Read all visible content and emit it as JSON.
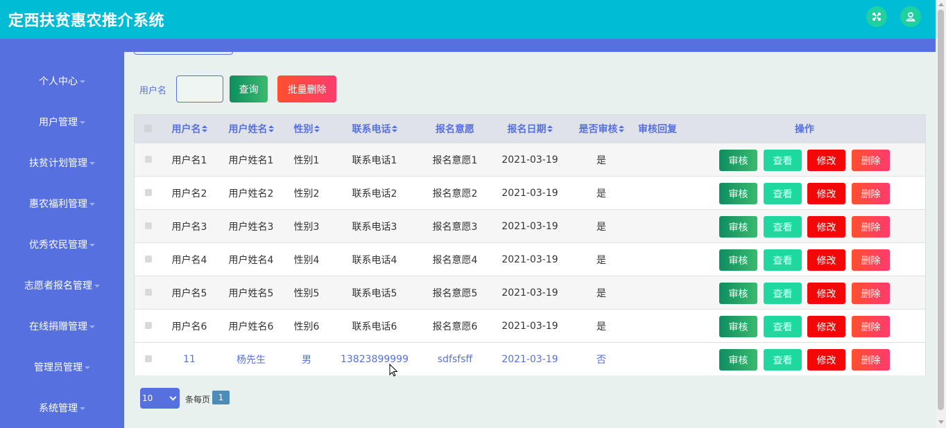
{
  "app": {
    "title": "定西扶贫惠农推介系统"
  },
  "header": {
    "icons": [
      "fullscreen-icon",
      "user-icon"
    ],
    "accent": "#00bcd4"
  },
  "sidebar": {
    "items": [
      {
        "label": "个人中心"
      },
      {
        "label": "用户管理"
      },
      {
        "label": "扶贫计划管理"
      },
      {
        "label": "惠农福利管理"
      },
      {
        "label": "优秀农民管理"
      },
      {
        "label": "志愿者报名管理"
      },
      {
        "label": "在线捐赠管理"
      },
      {
        "label": "管理员管理"
      },
      {
        "label": "系统管理"
      }
    ]
  },
  "search": {
    "label": "用户名",
    "value": "",
    "query_label": "查询",
    "batch_delete_label": "批量删除"
  },
  "table": {
    "columns": [
      "用户名",
      "用户姓名",
      "性别",
      "联系电话",
      "报名意愿",
      "报名日期",
      "是否审核",
      "审核回复",
      "操作"
    ],
    "rows": [
      {
        "username": "用户名1",
        "name": "用户姓名1",
        "gender": "性别1",
        "phone": "联系电话1",
        "wish": "报名意愿1",
        "date": "2021-03-19",
        "audited": "是",
        "reply": ""
      },
      {
        "username": "用户名2",
        "name": "用户姓名2",
        "gender": "性别2",
        "phone": "联系电话2",
        "wish": "报名意愿2",
        "date": "2021-03-19",
        "audited": "是",
        "reply": ""
      },
      {
        "username": "用户名3",
        "name": "用户姓名3",
        "gender": "性别3",
        "phone": "联系电话3",
        "wish": "报名意愿3",
        "date": "2021-03-19",
        "audited": "是",
        "reply": ""
      },
      {
        "username": "用户名4",
        "name": "用户姓名4",
        "gender": "性别4",
        "phone": "联系电话4",
        "wish": "报名意愿4",
        "date": "2021-03-19",
        "audited": "是",
        "reply": ""
      },
      {
        "username": "用户名5",
        "name": "用户姓名5",
        "gender": "性别5",
        "phone": "联系电话5",
        "wish": "报名意愿5",
        "date": "2021-03-19",
        "audited": "是",
        "reply": ""
      },
      {
        "username": "用户名6",
        "name": "用户姓名6",
        "gender": "性别6",
        "phone": "联系电话6",
        "wish": "报名意愿6",
        "date": "2021-03-19",
        "audited": "是",
        "reply": ""
      },
      {
        "username": "11",
        "name": "杨先生",
        "gender": "男",
        "phone": "13823899999",
        "wish": "sdfsfsff",
        "date": "2021-03-19",
        "audited": "否",
        "reply": ""
      }
    ],
    "actions": {
      "audit": "审核",
      "view": "查看",
      "edit": "修改",
      "delete": "删除"
    }
  },
  "pagination": {
    "page_size": "10",
    "per_page_label": "条每页",
    "current_page": "1"
  },
  "colors": {
    "sidebar": "#5670e0",
    "edit": "#f20808",
    "view": "#1fd8a0"
  }
}
